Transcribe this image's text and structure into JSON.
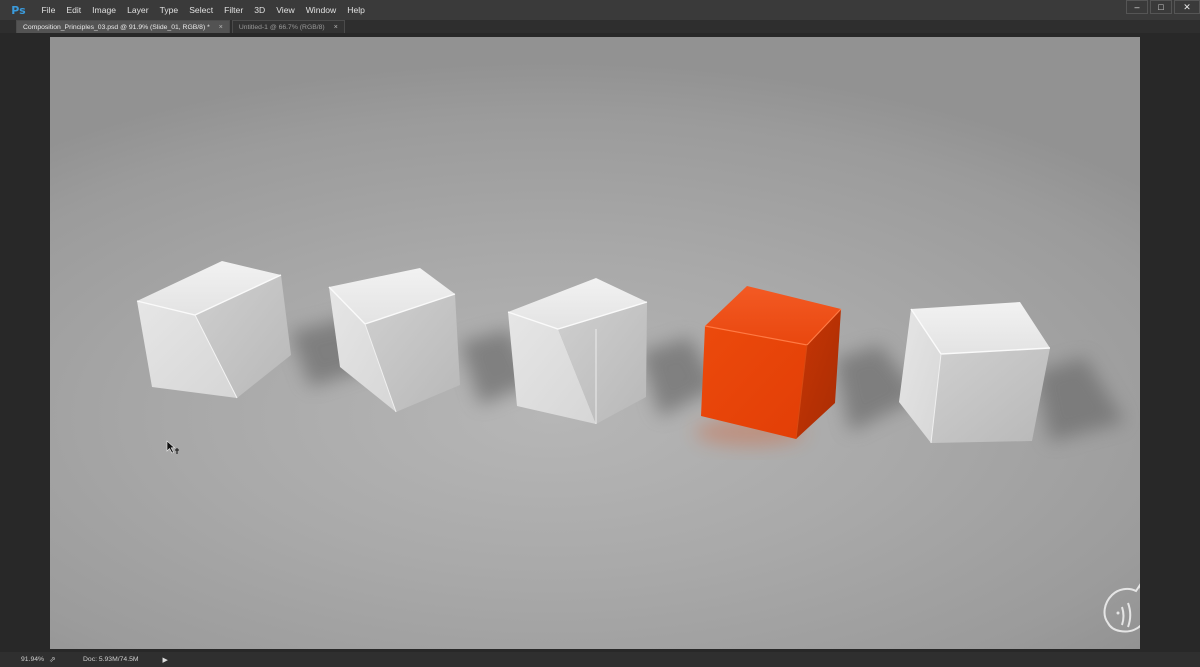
{
  "app": {
    "logo": "Ps"
  },
  "menu": [
    "File",
    "Edit",
    "Image",
    "Layer",
    "Type",
    "Select",
    "Filter",
    "3D",
    "View",
    "Window",
    "Help"
  ],
  "window_controls": {
    "minimize": "–",
    "maximize": "□",
    "close": "✕"
  },
  "tabs": [
    {
      "label": "Composition_Principles_03.psd @ 91.9% (Slide_01, RGB/8) *",
      "close": "×",
      "active": true
    },
    {
      "label": "Untitled-1 @ 66.7% (RGB/8)",
      "close": "×",
      "active": false
    }
  ],
  "canvas": {
    "cubes": [
      {
        "color": "white"
      },
      {
        "color": "white"
      },
      {
        "color": "white"
      },
      {
        "color": "orange",
        "accent": "#e8410d"
      },
      {
        "color": "white"
      }
    ],
    "watermark_icon": "hedgehog-logo-icon"
  },
  "status": {
    "zoom": "91.94%",
    "doc": "Doc: 5.93M/74.5M",
    "arrow": "▶"
  },
  "colors": {
    "accent": "#e8410d",
    "ps_logo": "#3a9bdc"
  }
}
